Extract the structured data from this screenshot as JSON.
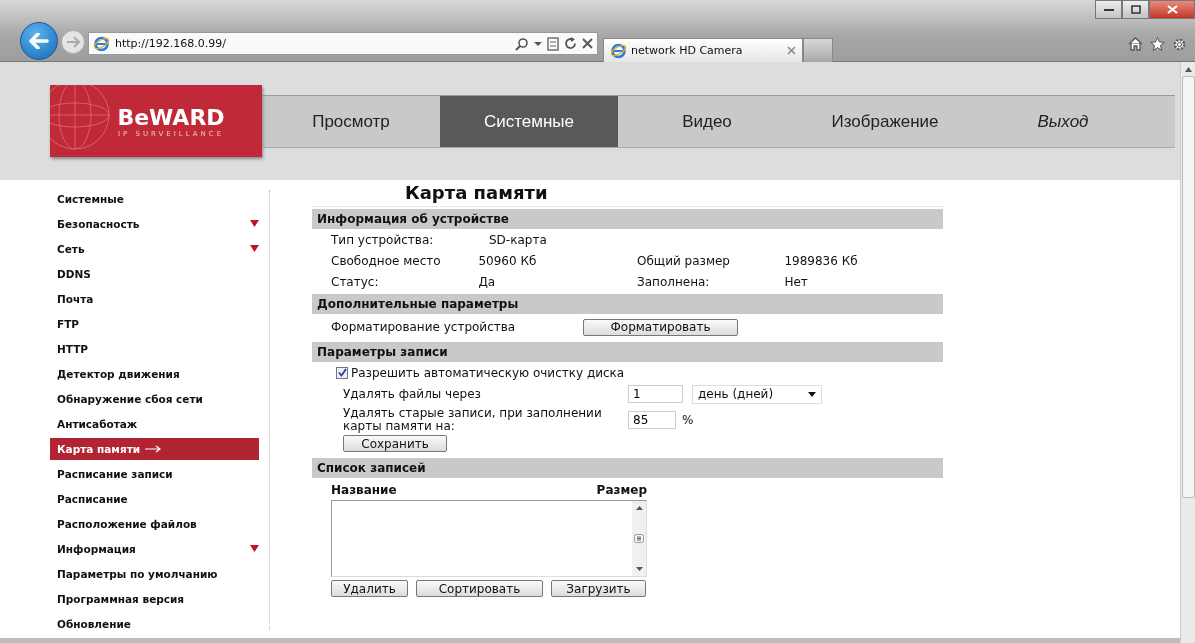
{
  "browser": {
    "address": "http://192.168.0.99/",
    "tab": {
      "title": "network HD Camera"
    }
  },
  "logo": {
    "brand": "BeWARD",
    "tagline": "IP SURVEILLANCE"
  },
  "nav": [
    {
      "label": "Просмотр",
      "selected": false,
      "kind": "page"
    },
    {
      "label": "Системные",
      "selected": true,
      "kind": "page"
    },
    {
      "label": "Видео",
      "selected": false,
      "kind": "page"
    },
    {
      "label": "Изображение",
      "selected": false,
      "kind": "page"
    },
    {
      "label": "Выход",
      "selected": false,
      "kind": "exit"
    }
  ],
  "sidebar": [
    {
      "label": "Системные",
      "selected": false,
      "expandable": false
    },
    {
      "label": "Безопасность",
      "selected": false,
      "expandable": true
    },
    {
      "label": "Сеть",
      "selected": false,
      "expandable": true
    },
    {
      "label": "DDNS",
      "selected": false,
      "expandable": false
    },
    {
      "label": "Почта",
      "selected": false,
      "expandable": false
    },
    {
      "label": "FTP",
      "selected": false,
      "expandable": false
    },
    {
      "label": "HTTP",
      "selected": false,
      "expandable": false
    },
    {
      "label": "Детектор движения",
      "selected": false,
      "expandable": false
    },
    {
      "label": "Обнаружение сбоя сети",
      "selected": false,
      "expandable": false
    },
    {
      "label": "Антисаботаж",
      "selected": false,
      "expandable": false
    },
    {
      "label": "Карта памяти",
      "selected": true,
      "expandable": false
    },
    {
      "label": "Расписание записи",
      "selected": false,
      "expandable": false
    },
    {
      "label": "Расписание",
      "selected": false,
      "expandable": false
    },
    {
      "label": "Расположение файлов",
      "selected": false,
      "expandable": false
    },
    {
      "label": "Информация",
      "selected": false,
      "expandable": true
    },
    {
      "label": "Параметры по умолчанию",
      "selected": false,
      "expandable": false
    },
    {
      "label": "Программная версия",
      "selected": false,
      "expandable": false
    },
    {
      "label": "Обновление",
      "selected": false,
      "expandable": false
    }
  ],
  "title": "Карта памяти",
  "device_info": {
    "heading": "Информация об устройстве",
    "rows": [
      [
        {
          "label": "Тип устройства:",
          "value": "SD-карта"
        }
      ],
      [
        {
          "label": "Свободное место",
          "value": "50960 Кб"
        },
        {
          "label": "Общий размер",
          "value": "1989836 Кб"
        }
      ],
      [
        {
          "label": "Статус:",
          "value": "Да"
        },
        {
          "label": "Заполнена:",
          "value": "Нет"
        }
      ]
    ]
  },
  "extra": {
    "heading": "Дополнительные параметры",
    "format_label": "Форматирование устройства",
    "format_button": "Форматировать"
  },
  "record": {
    "heading": "Параметры записи",
    "auto_clean": {
      "label": "Разрешить автоматическую очистку диска",
      "checked": true
    },
    "delete_after": {
      "label": "Удалять файлы через",
      "value": "1",
      "unit": "день (дней)"
    },
    "delete_old": {
      "label": "Удалять старые записи, при заполнении карты памяти на:",
      "value": "85",
      "unit": "%"
    },
    "save_button": "Сохранить"
  },
  "records": {
    "heading": "Список записей",
    "columns": [
      "Название",
      "Размер"
    ],
    "buttons": [
      "Удалить",
      "Сортировать",
      "Загрузить"
    ]
  }
}
